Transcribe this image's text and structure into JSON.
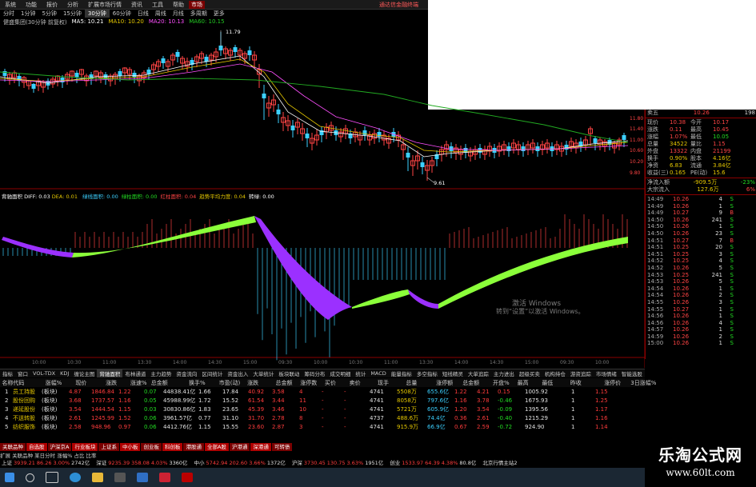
{
  "menu": {
    "items": [
      "系统",
      "功能",
      "报价",
      "分析",
      "扩展市场行情",
      "资讯",
      "工具",
      "帮助"
    ],
    "badge": "市场",
    "right_text": "通达信金融终端"
  },
  "periods": {
    "items": [
      "分时",
      "1分钟",
      "5分钟",
      "15分钟",
      "30分钟",
      "60分钟",
      "日线",
      "周线",
      "月线",
      "多周期",
      "更多"
    ],
    "active_index": 4
  },
  "ma_legend": {
    "title": "健盛集团(30分钟 前复权)",
    "ma1": "MA5: 10.21",
    "ma2": "MA10: 10.20",
    "ma3": "MA20: 10.13",
    "ma4": "MA60: 10.15"
  },
  "chart_labels": {
    "high": "11.79",
    "low": "9.61"
  },
  "price_axis": [
    "11.80",
    "11.40",
    "11.00",
    "10.60",
    "10.20",
    "9.80"
  ],
  "osc_legend": {
    "name": "背驰面积",
    "diff": "DIFF: 0.03",
    "dea": "DEA: 0.01",
    "items": [
      "绿线面积: 0.00",
      "绿柱面积: 0.00",
      "红柱面积: 0.04",
      "趋势平均力度: 0.04",
      "转绿: 0.00"
    ]
  },
  "quote": {
    "rows": [
      {
        "l": "卖五",
        "r": "10.26",
        "v": "198"
      },
      {
        "l": "现价",
        "r": "10.38",
        "l2": "今开",
        "r2": "10.17"
      },
      {
        "l": "涨跌",
        "r": "0.11",
        "l2": "最高",
        "r2": "10.45"
      },
      {
        "l": "涨幅",
        "r": "1.07%",
        "l2": "最低",
        "r2": "10.05"
      },
      {
        "l": "总量",
        "r": "34522",
        "l2": "量比",
        "r2": "1.15"
      },
      {
        "l": "外盘",
        "r": "13322",
        "l2": "内盘",
        "r2": "21199"
      },
      {
        "l": "换手",
        "r": "0.90%",
        "l2": "股本",
        "r2": "4.16亿"
      },
      {
        "l": "净资",
        "r": "6.83",
        "l2": "流通",
        "r2": "3.84亿"
      },
      {
        "l": "收益(三)",
        "r": "0.165",
        "l2": "PE(动)",
        "r2": "15.6"
      }
    ],
    "flow": [
      {
        "l": "净流入额",
        "r": "-909.5万",
        "p": "-23%"
      },
      {
        "l": "大宗流入",
        "r": "127.6万",
        "p": "6%"
      }
    ],
    "ticks": [
      [
        "14:49",
        "10.26",
        "4",
        "S"
      ],
      [
        "14:49",
        "10.26",
        "1",
        "S"
      ],
      [
        "14:49",
        "10.27",
        "9",
        "B"
      ],
      [
        "14:50",
        "10.26",
        "241",
        "S"
      ],
      [
        "14:50",
        "10.26",
        "1",
        "S"
      ],
      [
        "14:50",
        "10.26",
        "23",
        "S"
      ],
      [
        "14:51",
        "10.27",
        "7",
        "B"
      ],
      [
        "14:51",
        "10.25",
        "20",
        "S"
      ],
      [
        "14:51",
        "10.25",
        "3",
        "S"
      ],
      [
        "14:52",
        "10.25",
        "4",
        "S"
      ],
      [
        "14:52",
        "10.26",
        "5",
        "S"
      ],
      [
        "14:53",
        "10.25",
        "241",
        "S"
      ],
      [
        "14:53",
        "10.26",
        "5",
        "S"
      ],
      [
        "14:54",
        "10.26",
        "1",
        "S"
      ],
      [
        "14:54",
        "10.26",
        "2",
        "S"
      ],
      [
        "14:55",
        "10.26",
        "3",
        "S"
      ],
      [
        "14:55",
        "10.27",
        "1",
        "S"
      ],
      [
        "14:56",
        "10.26",
        "1",
        "S"
      ],
      [
        "14:56",
        "10.26",
        "4",
        "S"
      ],
      [
        "14:57",
        "10.26",
        "1",
        "S"
      ],
      [
        "14:59",
        "10.26",
        "2",
        "S"
      ],
      [
        "15:00",
        "10.26",
        "1",
        "S"
      ]
    ]
  },
  "tabs": [
    "指标",
    "窗口",
    "VOL-TDX",
    "KDJ",
    "缠论主图",
    "背驰面积",
    "布林通道",
    "主力趋势",
    "资金流向",
    "区间统计",
    "资金出入",
    "大单统计",
    "板块联动",
    "筹码分布",
    "成交明细",
    "统计",
    "MACD",
    "能量指标",
    "多空指标",
    "短线精灵",
    "大单追踪",
    "主力进出",
    "超级买卖",
    "机构持仓",
    "游资追踪",
    "市场情绪",
    "智能选股",
    "指标排序",
    "财务分析",
    "条件选股",
    "自选",
    "板块",
    "更多",
    "设置"
  ],
  "table": {
    "headers": [
      "名称代码",
      "涨幅%",
      "现价",
      "涨跌",
      "涨速%",
      "总金额",
      "换手%",
      "市盈(动)",
      "涨跌",
      "总金额",
      "涨停数",
      "买价",
      "卖价",
      "现手",
      "总量",
      "涨停额",
      "总金额",
      "开盘%",
      "最高",
      "最低",
      "昨收",
      "涨停价",
      "3日涨幅%"
    ],
    "rows": [
      {
        "n": "1",
        "name": "员工持股",
        "tag": "(板块)",
        "c1": "4.87",
        "c2": "1846.84",
        "c3": "1.22",
        "c4": "0.07",
        "c5": "44838.41亿",
        "c6": "1.66",
        "c7": "17.84",
        "c8": "40.92",
        "c9": "3.58",
        "c10": "4",
        "c11": "-",
        "c12": "-",
        "c13": "4741",
        "c14": "5508万",
        "c15": "655.6亿",
        "c16": "1.22",
        "c17": "4.21",
        "c18": "0.15",
        "c19": "1005.92",
        "c20": "1",
        "c21": "1.15"
      },
      {
        "n": "2",
        "name": "股份回购",
        "tag": "(板块)",
        "c1": "3.68",
        "c2": "1737.57",
        "c3": "1.16",
        "c4": "0.05",
        "c5": "45988.99亿",
        "c6": "1.72",
        "c7": "15.52",
        "c8": "61.54",
        "c9": "3.44",
        "c10": "11",
        "c11": "-",
        "c12": "-",
        "c13": "4741",
        "c14": "8058万",
        "c15": "797.6亿",
        "c16": "1.16",
        "c17": "3.78",
        "c18": "-0.46",
        "c19": "1675.93",
        "c20": "1",
        "c21": "1.25"
      },
      {
        "n": "3",
        "name": "递延股份",
        "tag": "(板块)",
        "c1": "3.54",
        "c2": "1444.54",
        "c3": "1.15",
        "c4": "0.03",
        "c5": "30830.86亿",
        "c6": "1.83",
        "c7": "23.65",
        "c8": "45.39",
        "c9": "3.46",
        "c10": "10",
        "c11": "-",
        "c12": "-",
        "c13": "4741",
        "c14": "5721万",
        "c15": "605.9亿",
        "c16": "1.20",
        "c17": "3.54",
        "c18": "-0.09",
        "c19": "1395.56",
        "c20": "1",
        "c21": "1.17"
      },
      {
        "n": "4",
        "name": "不送转股",
        "tag": "(板块)",
        "c1": "2.61",
        "c2": "1245.99",
        "c3": "1.52",
        "c4": "0.06",
        "c5": "3961.57亿",
        "c6": "0.77",
        "c7": "31.10",
        "c8": "31.70",
        "c9": "2.78",
        "c10": "8",
        "c11": "-",
        "c12": "-",
        "c13": "4737",
        "c14": "488.6万",
        "c15": "74.4亿",
        "c16": "0.36",
        "c17": "2.61",
        "c18": "-0.40",
        "c19": "1215.29",
        "c20": "1",
        "c21": "1.16"
      },
      {
        "n": "5",
        "name": "纺织服饰",
        "tag": "(板块)",
        "c1": "2.58",
        "c2": "948.96",
        "c3": "0.97",
        "c4": "0.06",
        "c5": "4412.76亿",
        "c6": "1.15",
        "c7": "15.55",
        "c8": "23.60",
        "c9": "2.87",
        "c10": "3",
        "c11": "-",
        "c12": "-",
        "c13": "4741",
        "c14": "915.9万",
        "c15": "66.9亿",
        "c16": "0.67",
        "c17": "2.59",
        "c18": "-0.72",
        "c19": "924.90",
        "c20": "1",
        "c21": "1.14"
      }
    ]
  },
  "bottom_tabs": [
    "关联品种",
    "自选股",
    "沪深京A",
    "行业板块",
    "上证系",
    "中小板",
    "创业板",
    "科创板",
    "港股通",
    "全部A股",
    "沪港通",
    "深港通",
    "可转债"
  ],
  "status": "扩展 关联品种  某日分时 涨幅% 占比 比率",
  "indexbar": [
    {
      "l": "上证",
      "v": "3939.21",
      "d": "86.26",
      "p": "3.00%",
      "a": "2742亿"
    },
    {
      "l": "深证",
      "v": "9235.39",
      "d": "358.08",
      "p": "4.03%",
      "a": "3360亿"
    },
    {
      "l": "中小",
      "v": "5742.94",
      "d": "202.60",
      "p": "3.66%",
      "a": "1372亿"
    },
    {
      "l": "沪深",
      "v": "3730.45",
      "d": "130.75",
      "p": "3.63%",
      "a": "1951亿"
    },
    {
      "l": "创业",
      "v": "1533.97",
      "d": "64.39",
      "p": "4.38%",
      "a": "80.8亿"
    }
  ],
  "indexbar_right": "北京行情主站2",
  "activate": {
    "line1": "激活 Windows",
    "line2": "转到“设置”以激活 Windows。"
  },
  "watermark": {
    "line1": "乐淘公式网",
    "line2": "www.60lt.com"
  },
  "time_axis": [
    "10:00",
    "10:30",
    "11:00",
    "13:30",
    "14:00",
    "14:30",
    "15:00",
    "09:30",
    "10:00",
    "10:30",
    "11:00",
    "13:30",
    "14:00",
    "14:30",
    "15:00",
    "09:30",
    "10:00"
  ]
}
